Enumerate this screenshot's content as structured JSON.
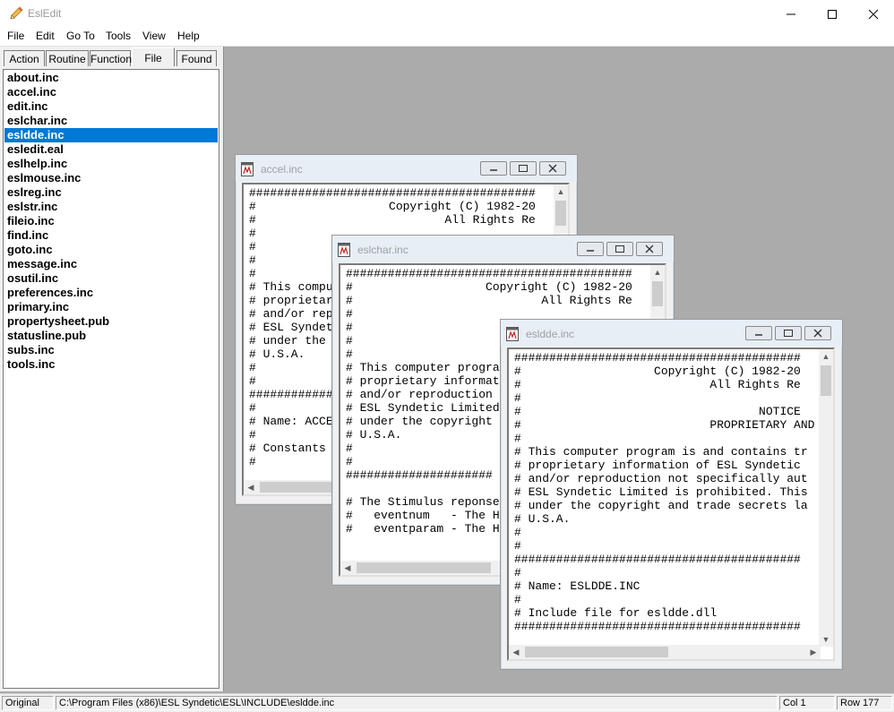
{
  "window": {
    "title": "EslEdit"
  },
  "menu": [
    "File",
    "Edit",
    "Go To",
    "Tools",
    "View",
    "Help"
  ],
  "tabs": [
    "Action",
    "Routine",
    "Function",
    "File",
    "Found"
  ],
  "active_tab": "File",
  "files": [
    "about.inc",
    "accel.inc",
    "edit.inc",
    "eslchar.inc",
    "esldde.inc",
    "esledit.eal",
    "eslhelp.inc",
    "eslmouse.inc",
    "eslreg.inc",
    "eslstr.inc",
    "fileio.inc",
    "find.inc",
    "goto.inc",
    "message.inc",
    "osutil.inc",
    "preferences.inc",
    "primary.inc",
    "propertysheet.pub",
    "statusline.pub",
    "subs.inc",
    "tools.inc"
  ],
  "selected_file": "esldde.inc",
  "children": [
    {
      "title": "accel.inc",
      "lines": [
        "#########################################",
        "#                   Copyright (C) 1982-20",
        "#                           All Rights Re",
        "#",
        "#",
        "#",
        "#",
        "# This compu",
        "# proprietar",
        "# and/or rep",
        "# ESL Syndet",
        "# under the ",
        "# U.S.A.",
        "#",
        "#",
        "############",
        "#",
        "# Name: ACCE",
        "#",
        "# Constants ",
        "#"
      ]
    },
    {
      "title": "eslchar.inc",
      "lines": [
        "#########################################",
        "#                   Copyright (C) 1982-20",
        "#                           All Rights Re",
        "#",
        "#",
        "#",
        "#",
        "# This computer progra",
        "# proprietary informat",
        "# and/or reproduction ",
        "# ESL Syndetic Limited",
        "# under the copyright ",
        "# U.S.A.",
        "#",
        "#",
        "#####################",
        "",
        "# The Stimulus reponse",
        "#   eventnum   - The H",
        "#   eventparam - The H"
      ]
    },
    {
      "title": "esldde.inc",
      "lines": [
        "#########################################",
        "#                   Copyright (C) 1982-20",
        "#                           All Rights Re",
        "#",
        "#                                  NOTICE",
        "#                           PROPRIETARY AND C",
        "#",
        "# This computer program is and contains tr",
        "# proprietary information of ESL Syndetic ",
        "# and/or reproduction not specifically aut",
        "# ESL Syndetic Limited is prohibited. This",
        "# under the copyright and trade secrets la",
        "# U.S.A.",
        "#",
        "#",
        "#########################################",
        "#",
        "# Name: ESLDDE.INC",
        "#",
        "# Include file for esldde.dll",
        "#########################################"
      ]
    }
  ],
  "status": {
    "mode": "Original",
    "path": "C:\\Program Files (x86)\\ESL Syndetic\\ESL\\INCLUDE\\esldde.inc",
    "col": "Col 1",
    "row": "Row 177"
  },
  "colors": {
    "selection": "#0078d7",
    "mdi_background": "#ababab"
  }
}
